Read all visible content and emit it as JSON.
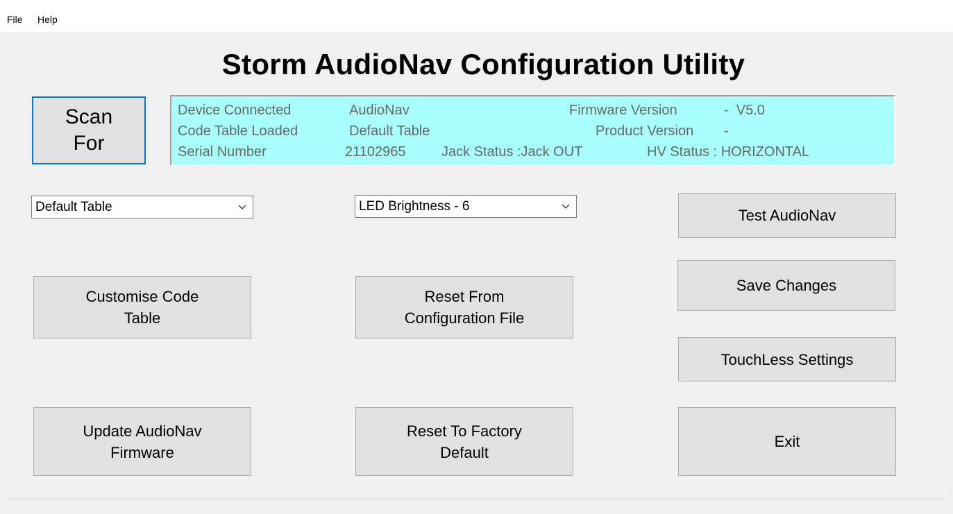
{
  "menu": {
    "file": "File",
    "help": "Help"
  },
  "title": "Storm AudioNav Configuration Utility",
  "scan_button": {
    "line1": "Scan",
    "line2": "For"
  },
  "info": {
    "device_connected_label": "Device Connected",
    "device_connected_value": "AudioNav",
    "firmware_version_label": "Firmware Version",
    "firmware_version_value": "-  V5.0",
    "code_table_loaded_label": "Code Table Loaded",
    "code_table_loaded_value": "Default Table",
    "product_version_label": "Product Version",
    "product_version_value": "-",
    "serial_number_label": "Serial Number",
    "serial_number_value": "21102965",
    "jack_status": "Jack Status :Jack OUT",
    "hv_status": "HV Status : HORIZONTAL"
  },
  "table_select": {
    "value": "Default Table"
  },
  "brightness_select": {
    "value": "LED Brightness - 6"
  },
  "buttons": {
    "test": "Test AudioNav",
    "save": "Save Changes",
    "touchless": "TouchLess Settings",
    "exit": "Exit",
    "customise_line1": "Customise Code",
    "customise_line2": "Table",
    "reset_config_line1": "Reset From",
    "reset_config_line2": "Configuration File",
    "update_line1": "Update AudioNav",
    "update_line2": "Firmware",
    "factory_line1": "Reset To Factory",
    "factory_line2": "Default"
  },
  "icons": {
    "dropdown": "chevron-down-icon"
  }
}
